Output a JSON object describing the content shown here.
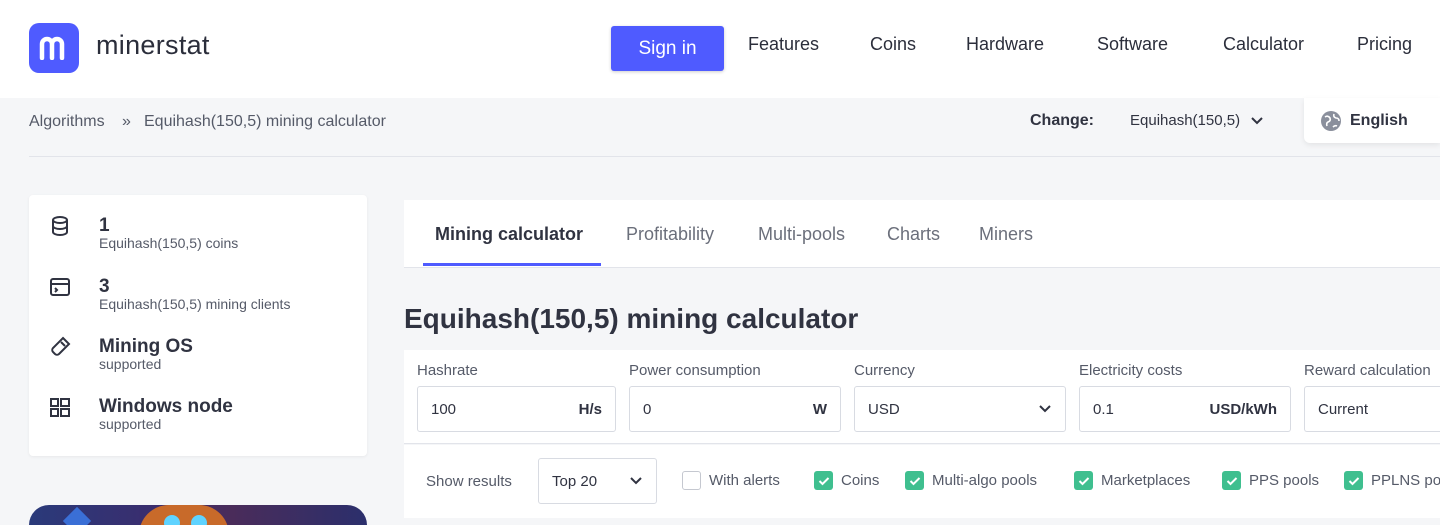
{
  "header": {
    "logo_text": "minerstat",
    "signin_label": "Sign in",
    "nav": [
      "Features",
      "Coins",
      "Hardware",
      "Software",
      "Calculator",
      "Pricing"
    ]
  },
  "breadcrumb": {
    "root": "Algorithms",
    "separator": "»",
    "current": "Equihash(150,5) mining calculator"
  },
  "change": {
    "label": "Change:",
    "value": "Equihash(150,5)"
  },
  "language": "English",
  "stats": [
    {
      "value": "1",
      "label": "Equihash(150,5) coins",
      "icon": "database-icon"
    },
    {
      "value": "3",
      "label": "Equihash(150,5) mining clients",
      "icon": "window-icon"
    },
    {
      "value": "Mining OS",
      "label": "supported",
      "icon": "usb-drive-icon"
    },
    {
      "value": "Windows node",
      "label": "supported",
      "icon": "windows-icon"
    }
  ],
  "tabs": [
    "Mining calculator",
    "Profitability",
    "Multi-pools",
    "Charts",
    "Miners"
  ],
  "page_title": "Equihash(150,5) mining calculator",
  "form": {
    "hashrate": {
      "label": "Hashrate",
      "value": "100",
      "unit": "H/s"
    },
    "power": {
      "label": "Power consumption",
      "value": "0",
      "unit": "W"
    },
    "currency": {
      "label": "Currency",
      "value": "USD"
    },
    "electricity": {
      "label": "Electricity costs",
      "value": "0.1",
      "unit": "USD/kWh"
    },
    "reward": {
      "label": "Reward calculation",
      "value": "Current"
    }
  },
  "filters": {
    "show_label": "Show results",
    "top_value": "Top 20",
    "checks": [
      {
        "label": "With alerts",
        "checked": false
      },
      {
        "label": "Coins",
        "checked": true
      },
      {
        "label": "Multi-algo pools",
        "checked": true
      },
      {
        "label": "Marketplaces",
        "checked": true
      },
      {
        "label": "PPS pools",
        "checked": true
      },
      {
        "label": "PPLNS pools",
        "checked": true
      }
    ]
  },
  "colors": {
    "brand": "#4f5bff",
    "check": "#3fbf8f"
  }
}
